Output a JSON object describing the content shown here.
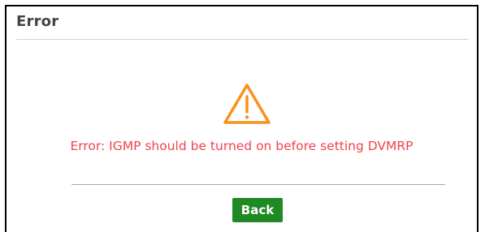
{
  "dialog": {
    "title": "Error",
    "icon": "warning-triangle-icon",
    "message": "Error: IGMP should be turned on before setting DVMRP",
    "back_label": "Back"
  },
  "colors": {
    "title_text": "#444444",
    "icon": "#f7921e",
    "message_text": "#f0434f",
    "button_bg": "#1f8a23",
    "button_text": "#ffffff"
  }
}
